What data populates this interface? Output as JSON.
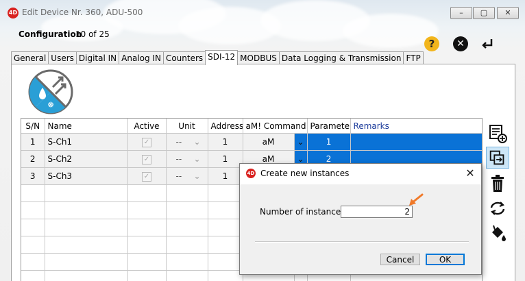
{
  "window": {
    "title": "Edit Device Nr. 360, ADU-500",
    "app_logo": "4D",
    "minimize_label": "–",
    "maximize_label": "▢",
    "close_label": "✕"
  },
  "header": {
    "config_label": "Configuration",
    "config_count": "10 of 25",
    "help_symbol": "?",
    "cancel_symbol": "✕"
  },
  "tabs": [
    {
      "label": "General",
      "active": false
    },
    {
      "label": "Users",
      "active": false
    },
    {
      "label": "Digital IN",
      "active": false
    },
    {
      "label": "Analog IN",
      "active": false
    },
    {
      "label": "Counters",
      "active": false
    },
    {
      "label": "SDI-12",
      "active": true
    },
    {
      "label": "MODBUS",
      "active": false
    },
    {
      "label": "Data Logging & Transmission",
      "active": false
    },
    {
      "label": "FTP",
      "active": false
    }
  ],
  "table": {
    "headers": {
      "sn": "S/N",
      "name": "Name",
      "active": "Active",
      "unit": "Unit",
      "address": "Address",
      "command": "aM! Command",
      "parameter": "Parameter",
      "remarks": "Remarks"
    },
    "rows": [
      {
        "sn": "1",
        "name": "S-Ch1",
        "check": "✓",
        "unit": "--",
        "address": "1",
        "command": "aM",
        "parameter": "1",
        "remarks": ""
      },
      {
        "sn": "2",
        "name": "S-Ch2",
        "check": "✓",
        "unit": "--",
        "address": "1",
        "command": "aM",
        "parameter": "2",
        "remarks": ""
      },
      {
        "sn": "3",
        "name": "S-Ch3",
        "check": "✓",
        "unit": "--",
        "address": "1",
        "command": "",
        "parameter": "",
        "remarks": ""
      }
    ]
  },
  "dialog": {
    "title": "Create new instances",
    "logo": "4D",
    "close_label": "✕",
    "label": "Number of instances",
    "value": "2",
    "cancel_label": "Cancel",
    "ok_label": "OK"
  },
  "colors": {
    "selection": "#0a72d6",
    "help": "#f2b51c",
    "accent_arrow": "#f07a2a",
    "sdi_blue": "#2a9fd6"
  }
}
